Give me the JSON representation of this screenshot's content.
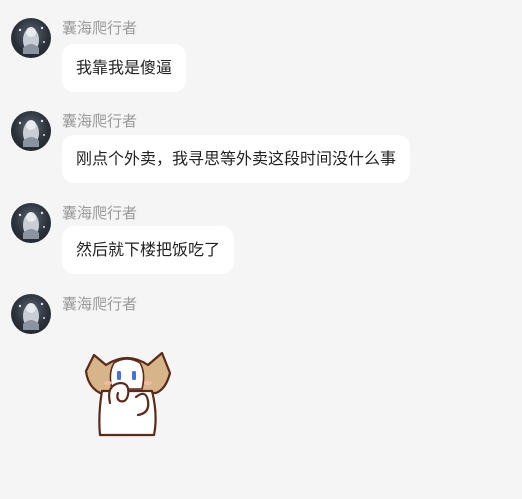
{
  "messages": [
    {
      "sender": "囊海爬行者",
      "text": "我靠我是傻逼"
    },
    {
      "sender": "囊海爬行者",
      "text": "刚点个外卖，我寻思等外卖这段时间没什么事"
    },
    {
      "sender": "囊海爬行者",
      "text": "然后就下楼把饭吃了"
    },
    {
      "sender": "囊海爬行者",
      "sticker": "hiding-face-cat-sticker"
    }
  ],
  "colors": {
    "background": "#f5f5f5",
    "bubble": "#ffffff",
    "sender_name": "#9a9a9a"
  }
}
